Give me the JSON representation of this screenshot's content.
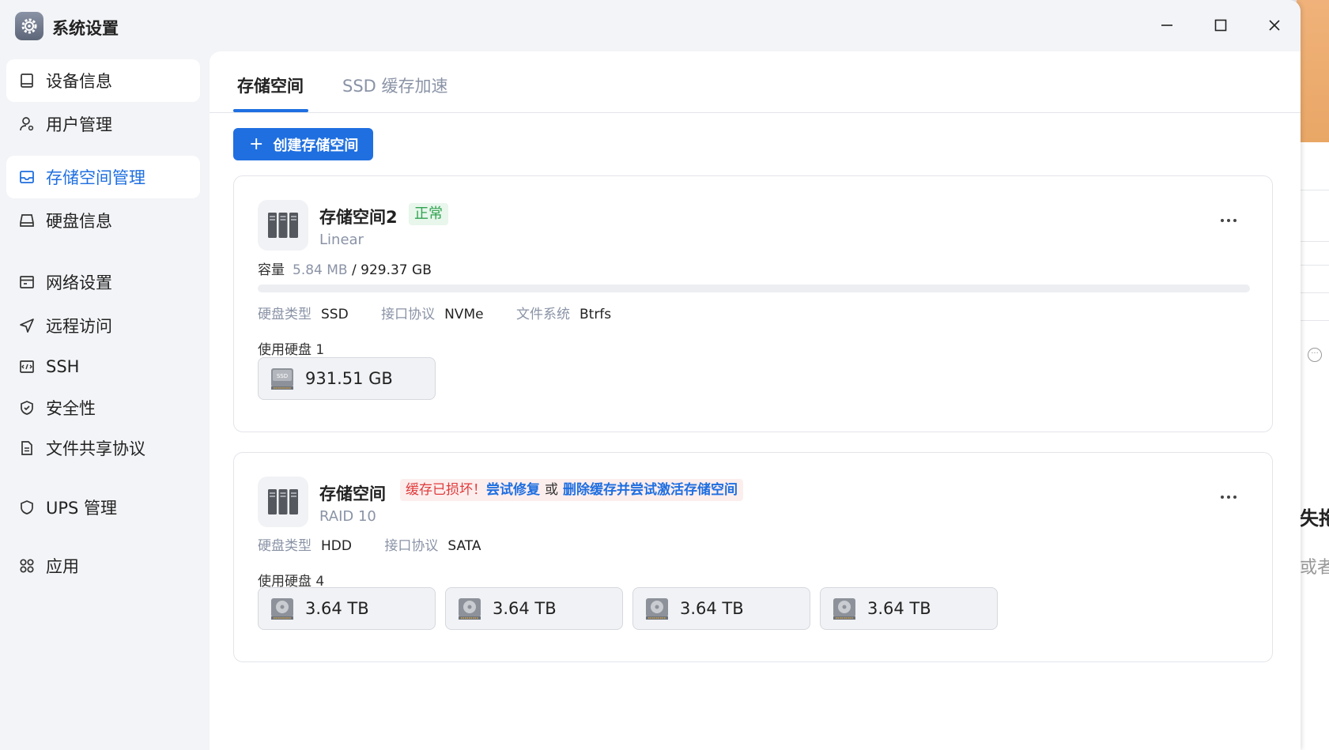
{
  "window": {
    "title": "系统设置"
  },
  "sidebar": {
    "items": [
      {
        "label": "设备信息",
        "icon": "device-icon"
      },
      {
        "label": "用户管理",
        "icon": "user-icon"
      },
      {
        "label": "存储空间管理",
        "icon": "storage-icon"
      },
      {
        "label": "硬盘信息",
        "icon": "disk-icon"
      },
      {
        "label": "网络设置",
        "icon": "network-icon"
      },
      {
        "label": "远程访问",
        "icon": "send-icon"
      },
      {
        "label": "SSH",
        "icon": "terminal-icon"
      },
      {
        "label": "安全性",
        "icon": "shield-check-icon"
      },
      {
        "label": "文件共享协议",
        "icon": "document-icon"
      },
      {
        "label": "UPS 管理",
        "icon": "shield-icon"
      },
      {
        "label": "应用",
        "icon": "apps-icon"
      }
    ]
  },
  "tabs": [
    {
      "label": "存储空间"
    },
    {
      "label": "SSD 缓存加速"
    }
  ],
  "create_button": {
    "plus": "+",
    "label": "创建存储空间"
  },
  "pools": [
    {
      "name": "存储空间2",
      "status": "正常",
      "type": "Linear",
      "capacity_label": "容量",
      "capacity_used": "5.84 MB",
      "capacity_total": "/ 929.37 GB",
      "usage_fraction": 0.0,
      "meta": [
        {
          "key": "硬盘类型",
          "value": "SSD"
        },
        {
          "key": "接口协议",
          "value": "NVMe"
        },
        {
          "key": "文件系统",
          "value": "Btrfs"
        }
      ],
      "disk_count_label": "使用硬盘 1",
      "disks": [
        {
          "size": "931.51 GB",
          "icon": "ssd-icon"
        }
      ]
    },
    {
      "name": "存储空间",
      "warning": {
        "error": "缓存已损坏！",
        "link1": "尝试修复",
        "or": "或",
        "link2": "删除缓存并尝试激活存储空间"
      },
      "type": "RAID 10",
      "meta": [
        {
          "key": "硬盘类型",
          "value": "HDD"
        },
        {
          "key": "接口协议",
          "value": "SATA"
        }
      ],
      "disk_count_label": "使用硬盘 4",
      "disks": [
        {
          "size": "3.64 TB",
          "icon": "hdd-icon"
        },
        {
          "size": "3.64 TB",
          "icon": "hdd-icon"
        },
        {
          "size": "3.64 TB",
          "icon": "hdd-icon"
        },
        {
          "size": "3.64 TB",
          "icon": "hdd-icon"
        }
      ]
    }
  ],
  "background": {
    "text1": "失拖",
    "text2": "或者"
  },
  "colors": {
    "accent": "#1f6fe0",
    "ok": "#2fa34f",
    "error": "#e03b3b"
  }
}
